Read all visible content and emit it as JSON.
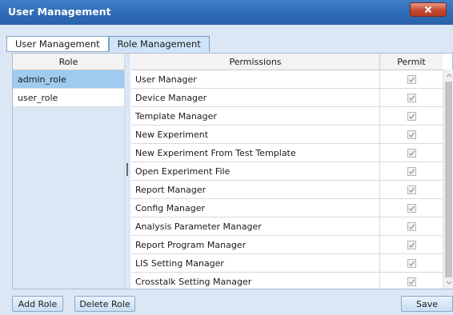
{
  "window": {
    "title": "User Management"
  },
  "tabs": [
    {
      "label": "User Management",
      "active": false
    },
    {
      "label": "Role Management",
      "active": true
    }
  ],
  "roles": {
    "header": "Role",
    "items": [
      {
        "label": "admin_role",
        "selected": true
      },
      {
        "label": "user_role",
        "selected": false
      }
    ]
  },
  "permissions": {
    "header_name": "Permissions",
    "header_permit": "Permit",
    "rows": [
      {
        "name": "User Manager",
        "permit": true
      },
      {
        "name": "Device Manager",
        "permit": true
      },
      {
        "name": "Template Manager",
        "permit": true
      },
      {
        "name": "New Experiment",
        "permit": true
      },
      {
        "name": "New Experiment From Test Template",
        "permit": true
      },
      {
        "name": "Open Experiment File",
        "permit": true
      },
      {
        "name": "Report Manager",
        "permit": true
      },
      {
        "name": "Config Manager",
        "permit": true
      },
      {
        "name": "Analysis Parameter Manager",
        "permit": true
      },
      {
        "name": "Report Program Manager",
        "permit": true
      },
      {
        "name": "LIS Setting Manager",
        "permit": true
      },
      {
        "name": "Crosstalk Setting Manager",
        "permit": true
      },
      {
        "name": "",
        "permit": true
      }
    ]
  },
  "buttons": {
    "add_role": "Add Role",
    "delete_role": "Delete Role",
    "save": "Save"
  },
  "colors": {
    "titlebar": "#2e6ab4",
    "selected_role": "#9fcbf0",
    "close_button": "#c54a32"
  }
}
